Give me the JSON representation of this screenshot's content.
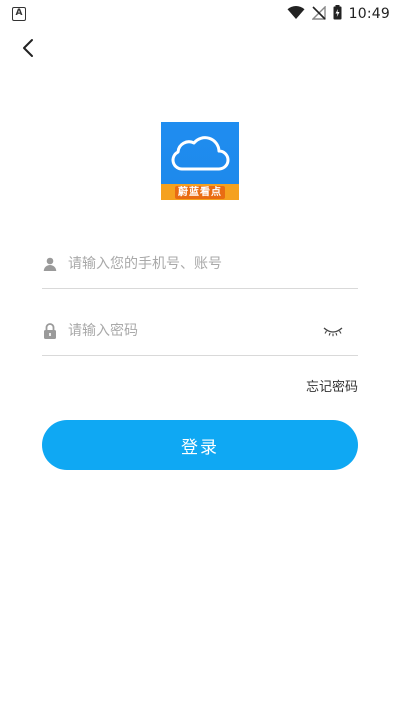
{
  "status_bar": {
    "left_badge": "A",
    "time": "10:49"
  },
  "logo": {
    "band_text": "蔚蓝看点"
  },
  "login_form": {
    "account_placeholder": "请输入您的手机号、账号",
    "password_placeholder": "请输入密码",
    "forgot_password_label": "忘记密码",
    "login_button_label": "登录"
  },
  "colors": {
    "accent": "#0fa8f3",
    "logo_blue": "#1e88ea",
    "logo_orange": "#f5a11f"
  },
  "icons": {
    "back": "chevron-left-icon",
    "user": "user-icon",
    "lock": "lock-icon",
    "eye": "eye-closed-icon"
  }
}
